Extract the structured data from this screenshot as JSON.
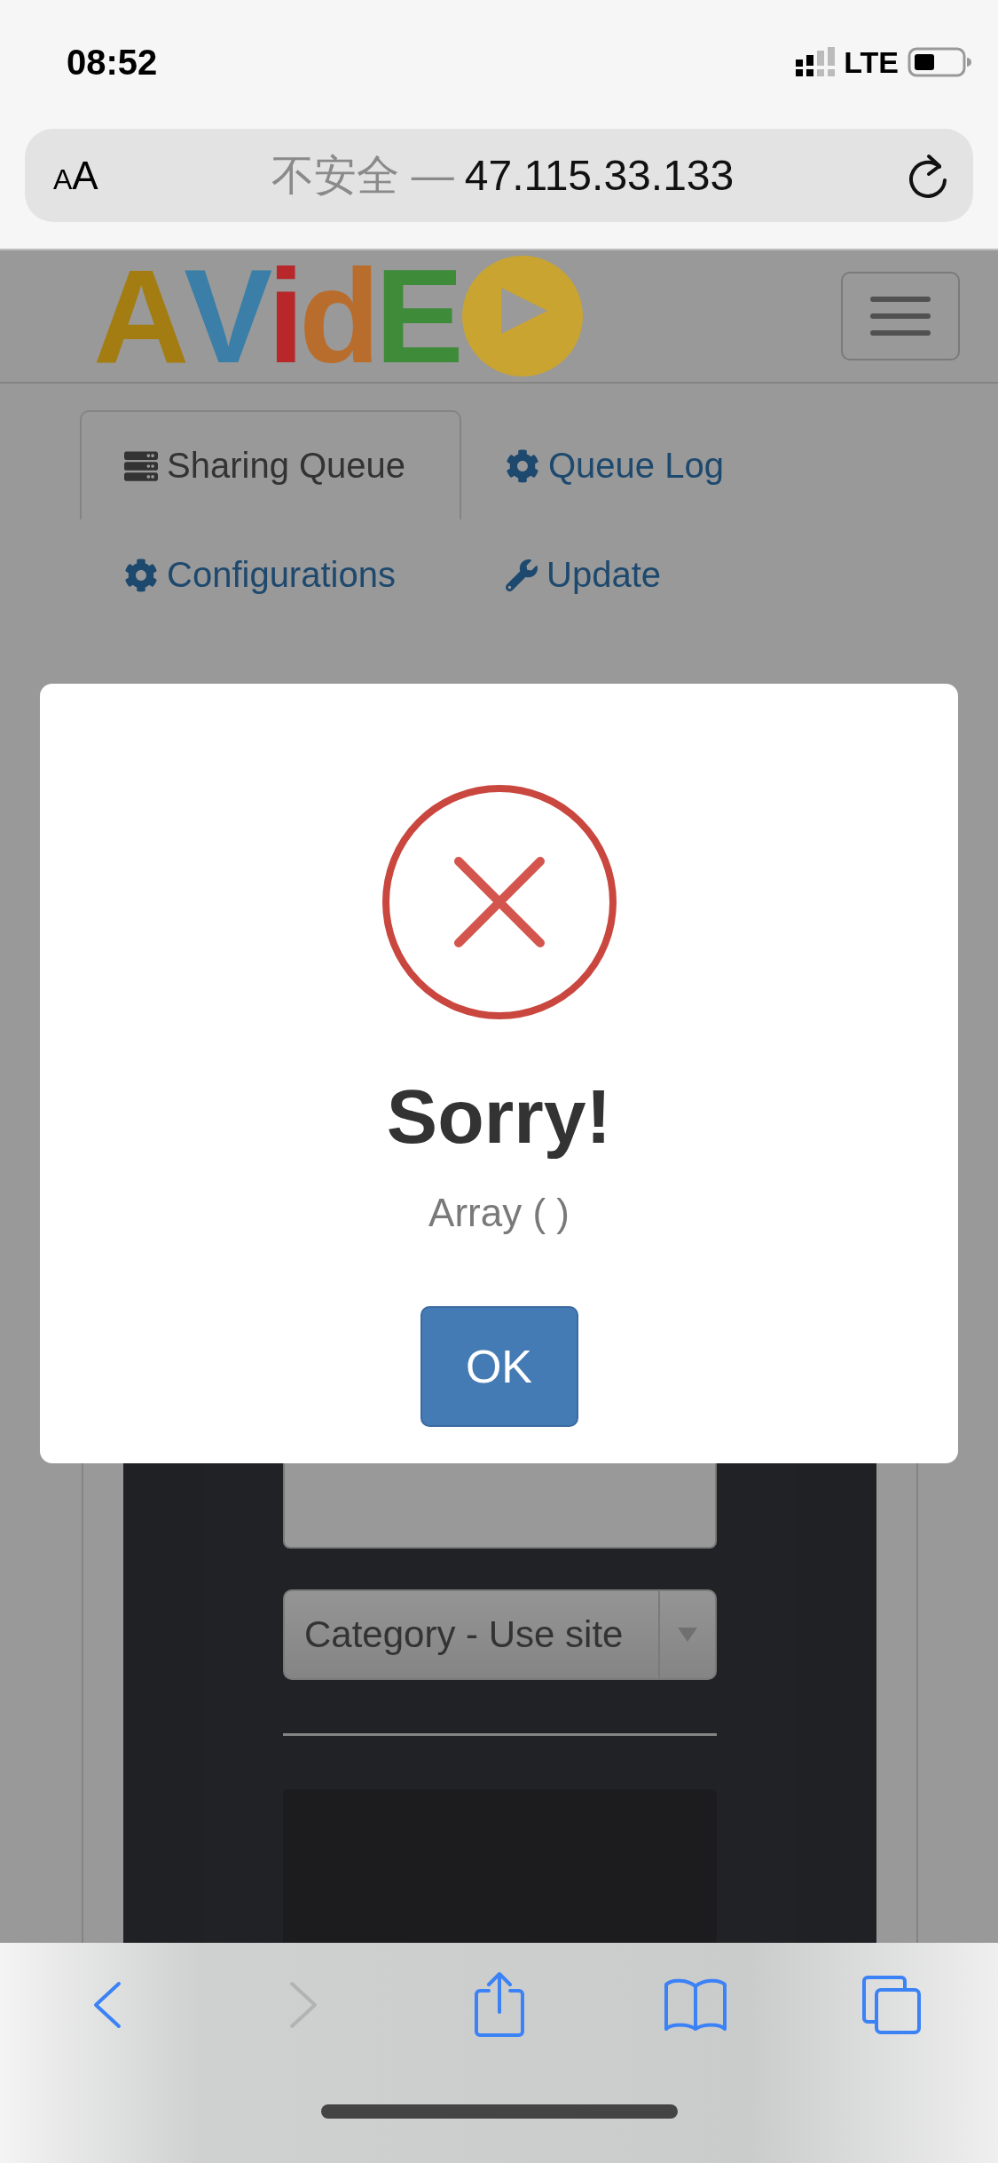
{
  "status_bar": {
    "time": "08:52",
    "network": "LTE"
  },
  "address_bar": {
    "text_size": [
      "A",
      "A"
    ],
    "security_note": "不安全 —",
    "address": "47.115.33.133"
  },
  "logo": {
    "letters": [
      {
        "char": "A",
        "color": "#a37d12"
      },
      {
        "char": "V",
        "color": "#3b7fa8"
      },
      {
        "char": "i",
        "color": "#b8282b"
      },
      {
        "char": "d",
        "color": "#b96d2c"
      },
      {
        "char": "E",
        "color": "#3e8b3a"
      }
    ]
  },
  "tabs": [
    {
      "label": "Sharing Queue",
      "kind": "server",
      "selected": true
    },
    {
      "label": "Queue Log",
      "kind": "gear",
      "selected": false
    },
    {
      "label": "Configurations",
      "kind": "gear",
      "selected": false
    },
    {
      "label": "Update",
      "kind": "wrench",
      "selected": false
    }
  ],
  "category_select": {
    "value": "Category - Use site"
  },
  "dialog": {
    "kind": "error",
    "title": "Sorry!",
    "message": "Array ( )",
    "button": "OK"
  },
  "toolbar": [
    {
      "kind": "back",
      "disabled": false
    },
    {
      "kind": "forward",
      "disabled": true
    },
    {
      "kind": "share",
      "disabled": false
    },
    {
      "kind": "bookmarks",
      "disabled": false
    },
    {
      "kind": "tabs",
      "disabled": false
    }
  ]
}
